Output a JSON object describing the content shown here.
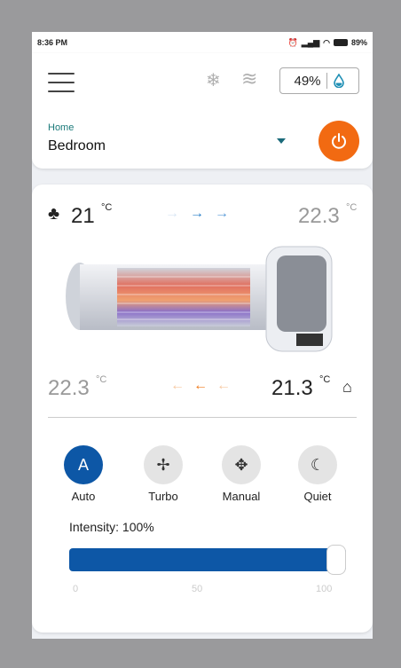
{
  "status": {
    "time": "8:36 PM",
    "battery": "89%"
  },
  "header": {
    "humidity": "49%",
    "home_label": "Home",
    "room": "Bedroom"
  },
  "panel": {
    "outdoor_in": "21",
    "outdoor_out": "22.3",
    "indoor_out": "22.3",
    "indoor_in": "21.3",
    "unit": "°C"
  },
  "modes": [
    {
      "label": "Auto",
      "glyph": "A",
      "active": true
    },
    {
      "label": "Turbo",
      "glyph": "✢",
      "active": false
    },
    {
      "label": "Manual",
      "glyph": "✥",
      "active": false
    },
    {
      "label": "Quiet",
      "glyph": "☾",
      "active": false
    }
  ],
  "intensity": {
    "label": "Intensity: 100%",
    "value_percent": 100,
    "ticks": [
      "0",
      "50",
      "100"
    ]
  },
  "colors": {
    "accent": "#0d57a6",
    "power": "#f26a12",
    "inflow": "#2a7fc8",
    "outflow": "#f07a1a"
  }
}
